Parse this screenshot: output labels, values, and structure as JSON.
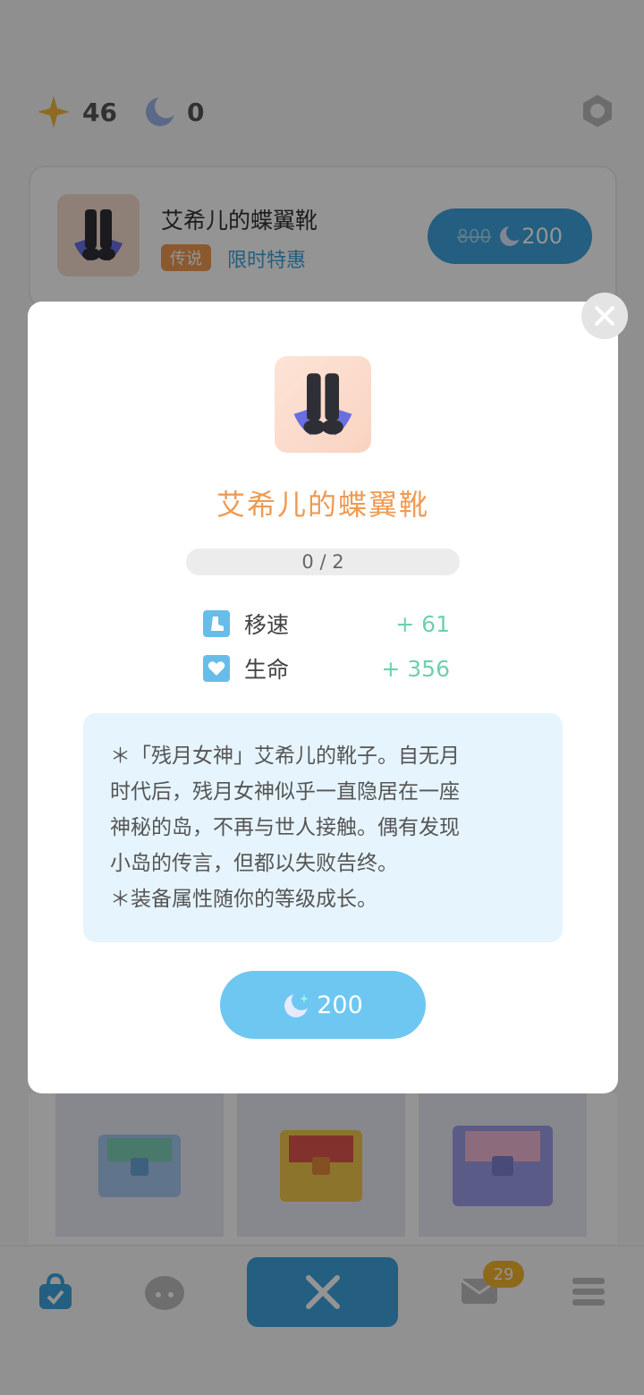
{
  "header": {
    "star_count": "46",
    "moon_count": "0"
  },
  "shop_item": {
    "title": "艾希儿的蝶翼靴",
    "rarity": "传说",
    "tag": "限时特惠",
    "old_price": "800",
    "price": "200"
  },
  "modal": {
    "title": "艾希儿的蝶翼靴",
    "progress": "0 / 2",
    "stats": [
      {
        "label": "移速",
        "value": "+ 61",
        "icon": "speed-boot-icon"
      },
      {
        "label": "生命",
        "value": "+ 356",
        "icon": "heart-icon"
      }
    ],
    "description": [
      "＊「残月女神」艾希儿的靴子。自无月",
      "时代后，残月女神似乎一直隐居在一座",
      "神秘的岛，不再与世人接触。偶有发现",
      "小岛的传言，但都以失败告终。",
      "＊装备属性随你的等级成长。"
    ],
    "buy_price": "200"
  },
  "nav": {
    "mail_badge": "29"
  },
  "colors": {
    "accent": "#3fa3dc",
    "title_orange": "#ef9a52",
    "stat_green": "#6ed0b0"
  }
}
